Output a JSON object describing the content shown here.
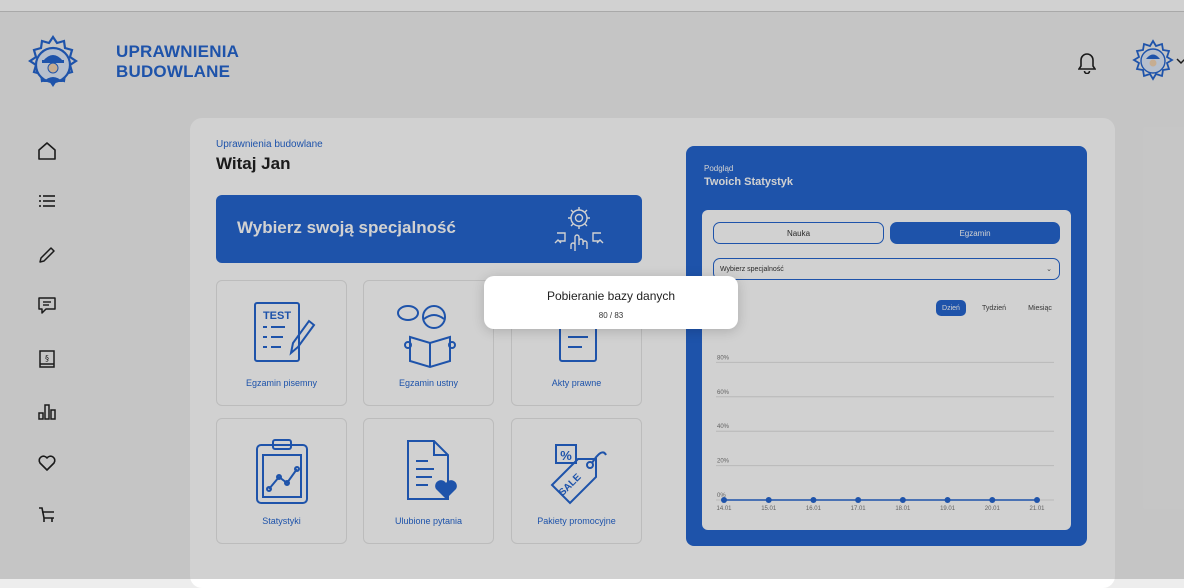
{
  "header": {
    "brand_line1": "UPRAWNIENIA",
    "brand_line2": "BUDOWLANE",
    "logo_icon": "engineer-gear-logo",
    "notification_icon": "bell-icon",
    "avatar_icon": "user-avatar-icon",
    "accent": "#2566d0"
  },
  "sidebar": {
    "items": [
      {
        "name": "home",
        "icon": "home-icon"
      },
      {
        "name": "list",
        "icon": "list-icon"
      },
      {
        "name": "edit",
        "icon": "pencil-icon"
      },
      {
        "name": "messages",
        "icon": "chat-icon"
      },
      {
        "name": "law",
        "icon": "law-book-icon"
      },
      {
        "name": "stats",
        "icon": "bar-chart-icon"
      },
      {
        "name": "favorites",
        "icon": "heart-icon"
      },
      {
        "name": "cart",
        "icon": "cart-icon"
      }
    ]
  },
  "welcome": {
    "subtitle": "Uprawnienia budowlane",
    "title": "Witaj Jan"
  },
  "banner": {
    "title": "Wybierz swoją specjalność"
  },
  "tiles": [
    {
      "label": "Egzamin pisemny",
      "icon": "test-sheet-icon"
    },
    {
      "label": "Egzamin ustny",
      "icon": "reading-person-icon"
    },
    {
      "label": "Akty prawne",
      "icon": "document-icon"
    },
    {
      "label": "Statystyki",
      "icon": "chart-clipboard-icon"
    },
    {
      "label": "Ulubione pytania",
      "icon": "favorite-document-icon"
    },
    {
      "label": "Pakiety promocyjne",
      "icon": "sale-tag-icon"
    }
  ],
  "stats": {
    "subtitle": "Podgląd",
    "title": "Twoich Statystyk",
    "tab_learning": "Nauka",
    "tab_exam": "Egzamin",
    "select_placeholder": "Wybierz specjalność",
    "range_day": "Dzień",
    "range_week": "Tydzień",
    "range_month": "Miesiąc"
  },
  "chart_data": {
    "type": "line",
    "x": [
      "14.01",
      "15.01",
      "16.01",
      "17.01",
      "18.01",
      "19.01",
      "20.01",
      "21.01"
    ],
    "series": [
      {
        "values": [
          0,
          0,
          0,
          0,
          0,
          0,
          0,
          0
        ]
      }
    ],
    "y_ticks": [
      "0%",
      "20%",
      "40%",
      "60%",
      "80%"
    ],
    "ylim": [
      0,
      100
    ],
    "grid": true,
    "color": "#2566d0"
  },
  "modal": {
    "title": "Pobieranie bazy danych",
    "progress": "80 / 83"
  }
}
